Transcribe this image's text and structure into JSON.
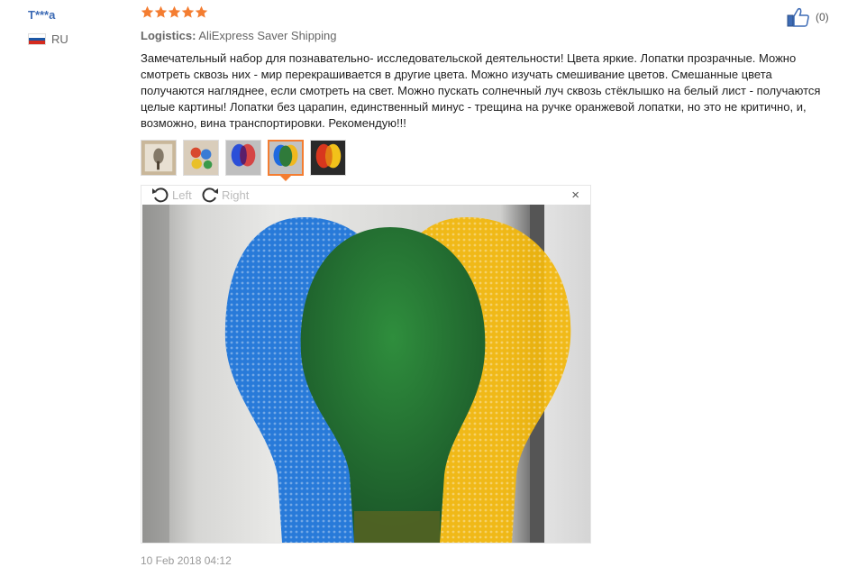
{
  "user": {
    "name": "T***a",
    "country": "RU",
    "flag_colors": [
      "#ffffff",
      "#1c57a5",
      "#d52b1e"
    ]
  },
  "rating": {
    "stars": 5,
    "max": 5,
    "color": "#f47d31"
  },
  "logistics": {
    "label": "Logistics:",
    "value": "AliExpress Saver Shipping"
  },
  "review": {
    "text": "Замечательный набор для познавательно- исследовательской деятельности! Цвета яркие. Лопатки прозрачные. Можно смотреть сквозь них - мир перекрашивается в другие цвета. Можно изучать смешивание цветов. Смешанные цвета получаются нагляднее, если смотреть на свет. Можно пускать солнечный луч сквозь стёклышко на белый лист - получаются целые картины! Лопатки без царапин, единственный минус - трещина на ручке оранжевой лопатки, но это не критично, и, возможно, вина транспортировки. Рекомендую!!!"
  },
  "helpful": {
    "count_text": "(0)",
    "icon": "thumbs-up-icon"
  },
  "thumbnails": {
    "count": 5,
    "active_index": 3,
    "accent": "#f47d31"
  },
  "viewer": {
    "rotate_left": "Left",
    "rotate_right": "Right",
    "close": "×"
  },
  "date": "10 Feb 2018 04:12"
}
